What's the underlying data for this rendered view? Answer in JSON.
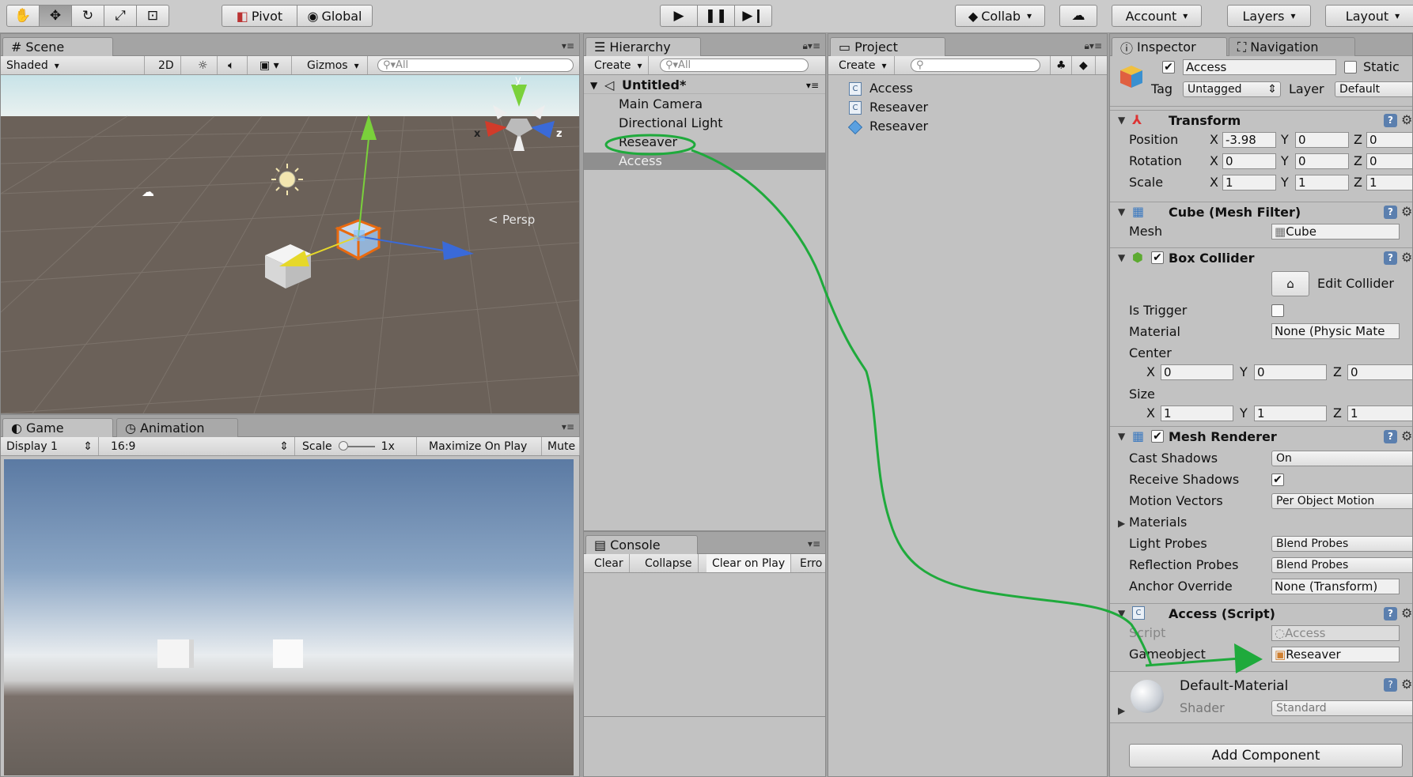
{
  "toolbar": {
    "tools": [
      "hand-tool",
      "move-tool",
      "rotate-tool",
      "scale-tool",
      "rect-tool"
    ],
    "pivot": "Pivot",
    "global": "Global",
    "collab": "Collab",
    "account": "Account",
    "layers": "Layers",
    "layout": "Layout"
  },
  "scene": {
    "tab": "Scene",
    "shading": "Shaded",
    "mode2d": "2D",
    "gizmos": "Gizmos",
    "search_placeholder": "All",
    "persp": "Persp",
    "axes": {
      "x": "x",
      "y": "y",
      "z": "z"
    }
  },
  "game": {
    "tab": "Game",
    "tab2": "Animation",
    "display": "Display 1",
    "aspect": "16:9",
    "scale_label": "Scale",
    "scale_value": "1x",
    "maximize": "Maximize On Play",
    "mute": "Mute"
  },
  "hierarchy": {
    "tab": "Hierarchy",
    "create": "Create",
    "search_placeholder": "All",
    "scene_name": "Untitled*",
    "items": [
      "Main Camera",
      "Directional Light",
      "Reseaver",
      "Access"
    ],
    "selected": "Access"
  },
  "project": {
    "tab": "Project",
    "create": "Create",
    "items": [
      {
        "name": "Access",
        "icon": "script-icon"
      },
      {
        "name": "Reseaver",
        "icon": "script-icon"
      },
      {
        "name": "Reseaver",
        "icon": "prefab-icon"
      }
    ]
  },
  "console": {
    "tab": "Console",
    "buttons": [
      "Clear",
      "Collapse",
      "Clear on Play",
      "Erro"
    ]
  },
  "inspector": {
    "tab": "Inspector",
    "tab2": "Navigation",
    "object_name": "Access",
    "static_label": "Static",
    "tag_label": "Tag",
    "tag": "Untagged",
    "layer_label": "Layer",
    "layer": "Default",
    "transform": {
      "title": "Transform",
      "position_label": "Position",
      "rotation_label": "Rotation",
      "scale_label": "Scale",
      "position": [
        "-3.98",
        "0",
        "0"
      ],
      "rotation": [
        "0",
        "0",
        "0"
      ],
      "scale": [
        "1",
        "1",
        "1"
      ]
    },
    "mesh_filter": {
      "title": "Cube (Mesh Filter)",
      "mesh_label": "Mesh",
      "mesh": "Cube"
    },
    "box_collider": {
      "title": "Box Collider",
      "edit": "Edit Collider",
      "is_trigger": "Is Trigger",
      "material_label": "Material",
      "material": "None (Physic Mate",
      "center_label": "Center",
      "center": [
        "0",
        "0",
        "0"
      ],
      "size_label": "Size",
      "size": [
        "1",
        "1",
        "1"
      ]
    },
    "mesh_renderer": {
      "title": "Mesh Renderer",
      "cast_shadows_label": "Cast Shadows",
      "cast_shadows": "On",
      "receive_shadows_label": "Receive Shadows",
      "motion_vectors_label": "Motion Vectors",
      "motion_vectors": "Per Object Motion",
      "materials_label": "Materials",
      "light_probes_label": "Light Probes",
      "light_probes": "Blend Probes",
      "reflection_probes_label": "Reflection Probes",
      "reflection_probes": "Blend Probes",
      "anchor_label": "Anchor Override",
      "anchor": "None (Transform)"
    },
    "access_script": {
      "title": "Access (Script)",
      "script_label": "Script",
      "script": "Access",
      "gameobject_label": "Gameobject",
      "gameobject": "Reseaver"
    },
    "material": {
      "name": "Default-Material",
      "shader_label": "Shader",
      "shader": "Standard"
    },
    "add_component": "Add Component"
  },
  "colors": {
    "annotation": "#1faa3c",
    "selection": "#8f8f8f"
  }
}
